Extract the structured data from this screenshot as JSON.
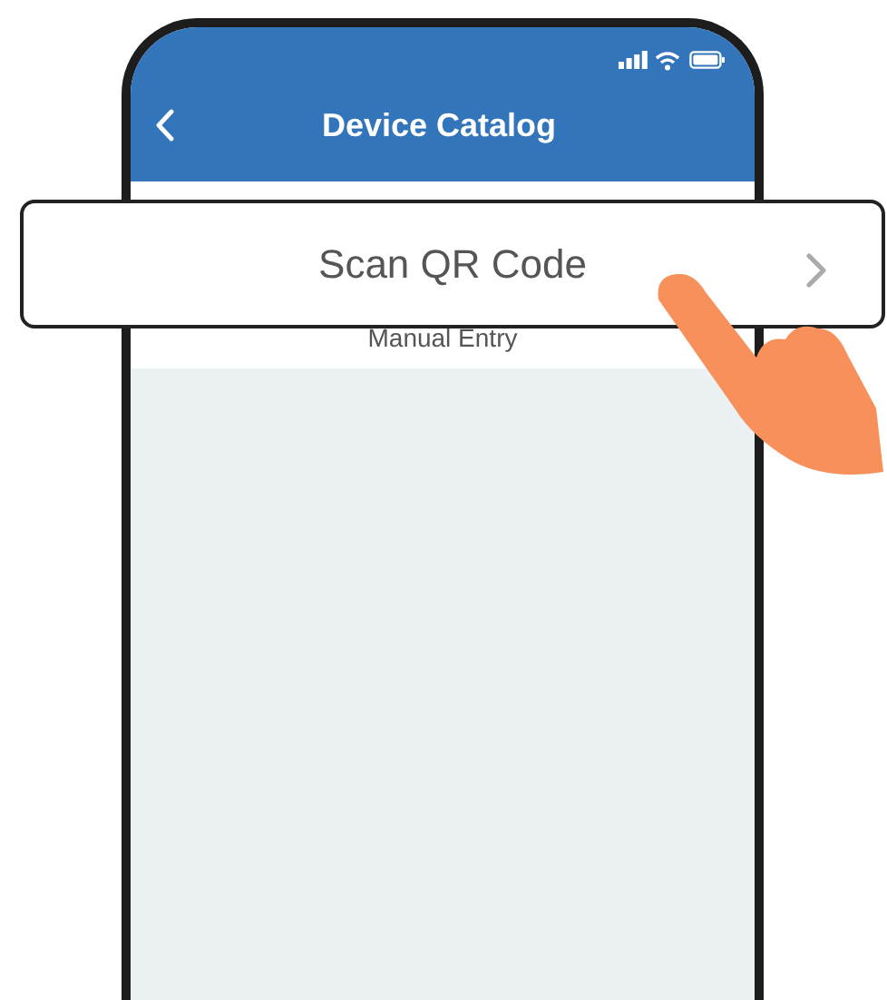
{
  "header": {
    "title": "Device Catalog"
  },
  "scan_option": {
    "label": "Scan QR Code"
  },
  "manual_entry": {
    "label": "Manual Entry"
  }
}
